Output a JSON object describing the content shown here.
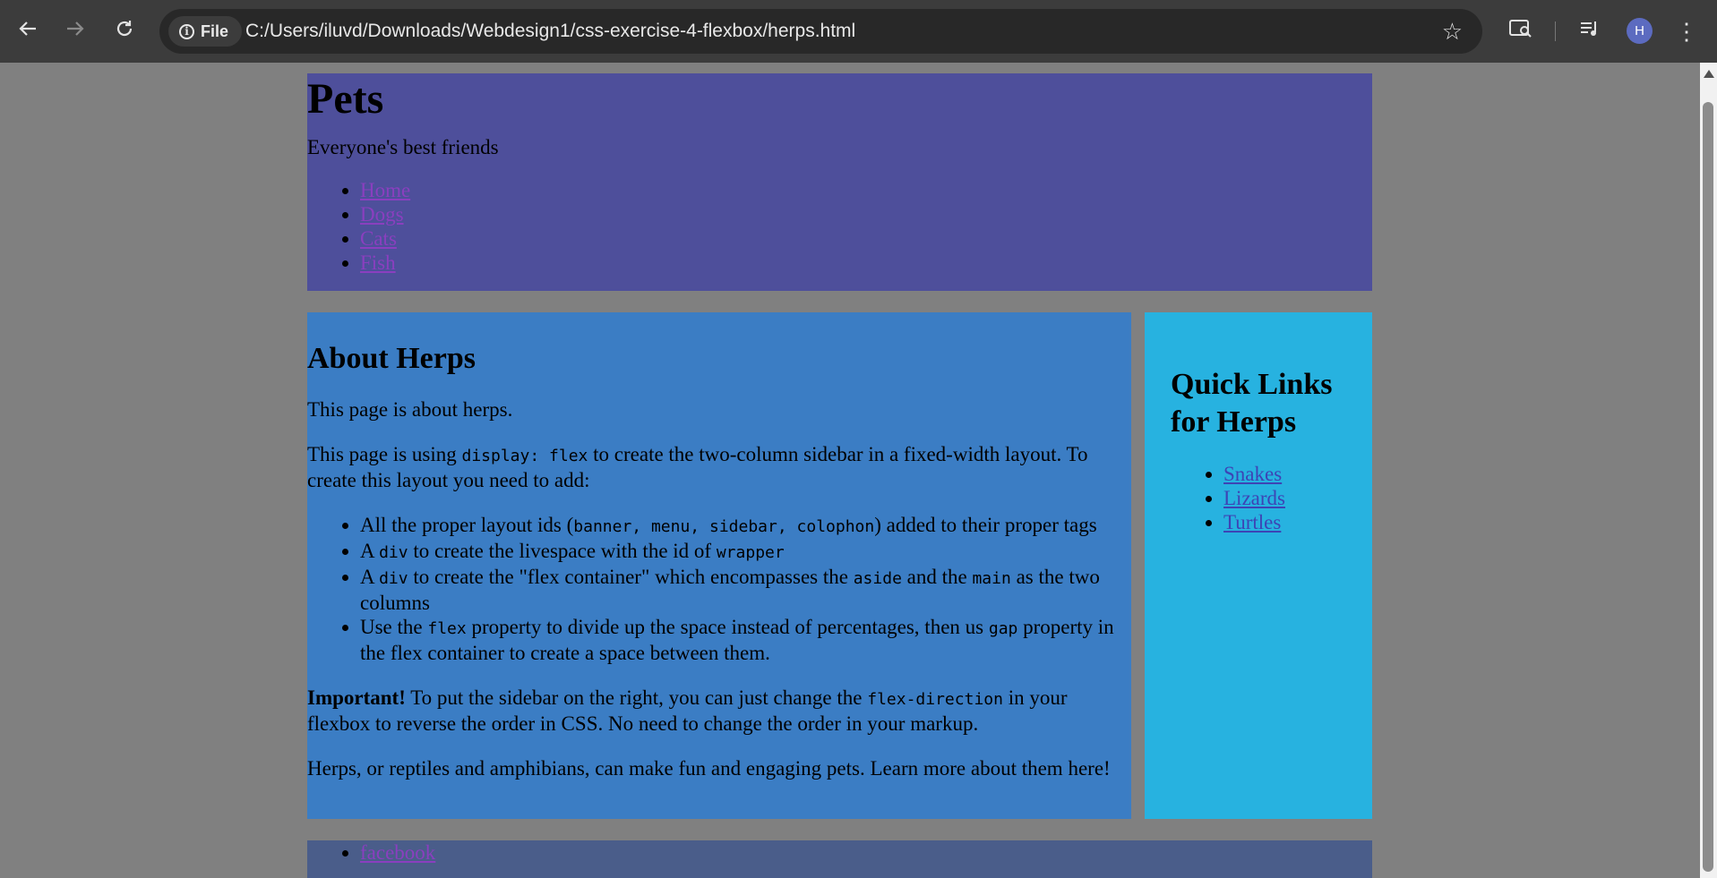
{
  "browser": {
    "back_icon": "arrow-left-icon",
    "forward_icon": "arrow-right-icon",
    "reload_icon": "reload-icon",
    "site_chip": "File",
    "url": "C:/Users/iluvd/Downloads/Webdesign1/css-exercise-4-flexbox/herps.html",
    "avatar_letter": "H"
  },
  "banner": {
    "title": "Pets",
    "tagline": "Everyone's best friends"
  },
  "menu": {
    "items": [
      {
        "label": "Home"
      },
      {
        "label": "Dogs"
      },
      {
        "label": "Cats"
      },
      {
        "label": "Fish"
      }
    ]
  },
  "main": {
    "heading": "About Herps",
    "p1": "This page is about herps.",
    "p2_pre": "This page is using ",
    "p2_code": "display: flex",
    "p2_post": " to create the two-column sidebar in a fixed-width layout. To create this layout you need to add:",
    "list": {
      "i1_pre": "All the proper layout ids (",
      "i1_code": "banner, menu, sidebar, colophon",
      "i1_post": ") added to their proper tags",
      "i2_pre": "A ",
      "i2_code1": "div",
      "i2_mid": " to create the livespace with the id of ",
      "i2_code2": "wrapper",
      "i3_pre": "A ",
      "i3_code1": "div",
      "i3_mid1": " to create the \"flex container\" which encompasses the ",
      "i3_code2": "aside",
      "i3_mid2": " and the ",
      "i3_code3": "main",
      "i3_post": " as the two columns",
      "i4_pre": "Use the ",
      "i4_code1": "flex",
      "i4_mid": " property to divide up the space instead of percentages, then us ",
      "i4_code2": "gap",
      "i4_post": " property in the flex container to create a space between them."
    },
    "important_label": "Important!",
    "important_pre": " To put the sidebar on the right, you can just change the ",
    "important_code": "flex-direction",
    "important_post": " in your flexbox to reverse the order in CSS. No need to change the order in your markup.",
    "p_last": "Herps, or reptiles and amphibians, can make fun and engaging pets. Learn more about them here!"
  },
  "sidebar": {
    "heading": "Quick Links for Herps",
    "links": [
      {
        "label": "Snakes"
      },
      {
        "label": "Lizards"
      },
      {
        "label": "Turtles"
      }
    ]
  },
  "colophon": {
    "links": [
      {
        "label": "facebook"
      }
    ]
  },
  "colors": {
    "banner": "#4e4f9b",
    "main": "#3b7dc4",
    "sidebar": "#27b2e0",
    "colophon": "#4a5d8a",
    "page_bg": "#808080"
  }
}
